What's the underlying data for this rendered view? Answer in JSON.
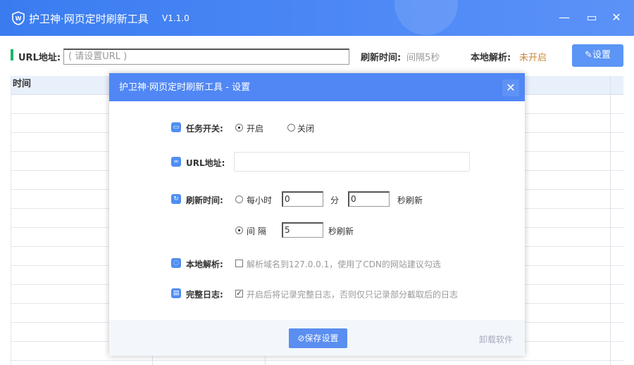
{
  "app": {
    "title": "护卫神·网页定时刷新工具",
    "version": "V1.1.0"
  },
  "toolbar": {
    "url_label": "URL地址:",
    "url_placeholder": "( 请设置URL )",
    "refresh_label": "刷新时间:",
    "refresh_value": "间隔5秒",
    "local_label": "本地解析:",
    "local_value": "未开启",
    "settings_button": "设置"
  },
  "table": {
    "columns": [
      "时间"
    ]
  },
  "dialog": {
    "title": "护卫神·网页定时刷新工具 - 设置",
    "task_label": "任务开关:",
    "task_on": "开启",
    "task_off": "关闭",
    "task_state": "on",
    "url_label": "URL地址:",
    "url_value": "",
    "refresh_label": "刷新时间:",
    "hourly_label": "每小时",
    "hourly_min": "0",
    "min_unit": "分",
    "hourly_sec": "0",
    "sec_refresh": "秒刷新",
    "interval_label": "间 隔",
    "interval_value": "5",
    "interval_unit": "秒刷新",
    "refresh_mode": "interval",
    "local_label": "本地解析:",
    "local_desc": "解析域名到127.0.0.1，使用了CDN的网站建议勾选",
    "local_checked": false,
    "log_label": "完整日志:",
    "log_desc": "开启后将记录完整日志，否则仅只记录部分截取后的日志",
    "log_checked": true,
    "save_button": "保存设置",
    "uninstall": "卸载软件"
  }
}
